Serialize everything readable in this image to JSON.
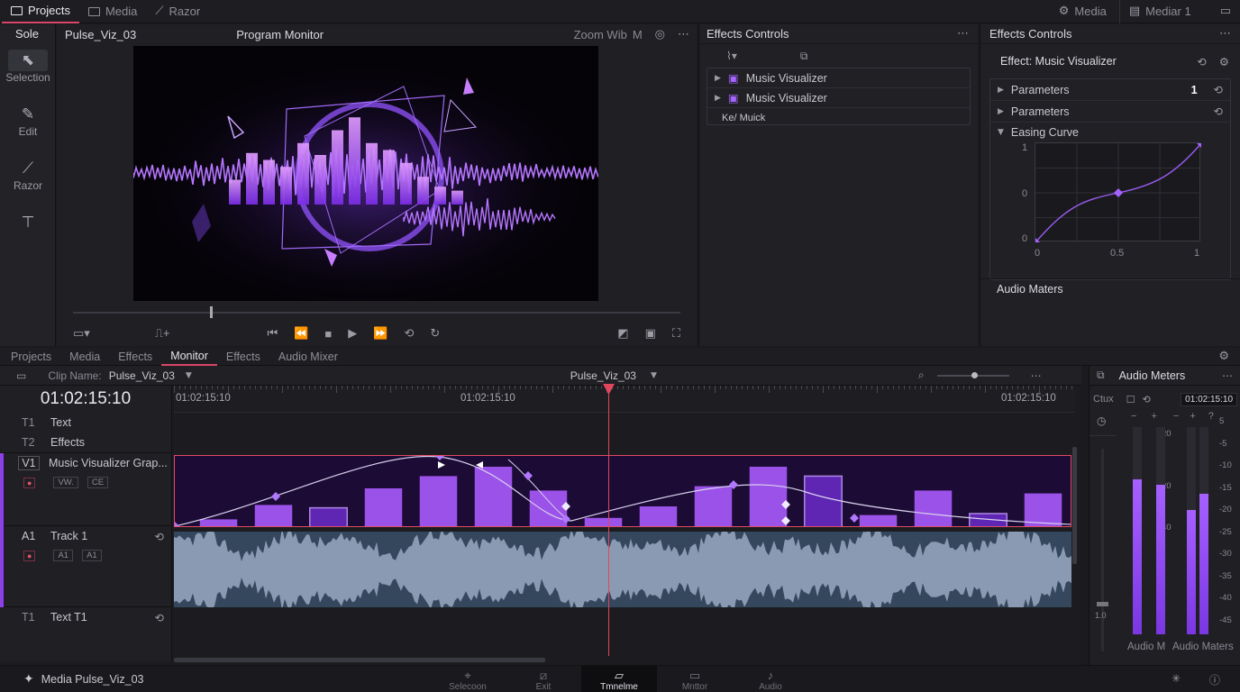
{
  "topbar": {
    "left_tabs": [
      {
        "label": "Projects",
        "icon": "folder-icon"
      },
      {
        "label": "Media",
        "icon": "folder-icon"
      },
      {
        "label": "Razor",
        "icon": "razor-icon"
      }
    ],
    "right_tabs": [
      {
        "label": "Media",
        "icon": "gear-icon"
      },
      {
        "label": "Mediar 1",
        "icon": "media-icon"
      }
    ]
  },
  "tools": {
    "header": "Sole",
    "items": [
      {
        "label": "Selection",
        "icon": "cursor-icon"
      },
      {
        "label": "Edit",
        "icon": "pen-icon"
      },
      {
        "label": "Razor",
        "icon": "razor-icon"
      },
      {
        "label": "",
        "icon": "text-tool-icon"
      }
    ]
  },
  "monitor": {
    "clip_name": "Pulse_Viz_03",
    "title": "Program Monitor",
    "zoom_label": "Zoom Wib",
    "zoom_value": "M"
  },
  "effects_mid": {
    "title": "Effects Controls",
    "items": [
      "Music Visualizer",
      "Music Visualizer"
    ],
    "footer": "Ke/ Muick"
  },
  "effects_right": {
    "title": "Effects Controls",
    "effect_label": "Effect: Music Visualizer",
    "rows": [
      {
        "label": "Parameters",
        "value": "1"
      },
      {
        "label": "Parameters",
        "value": ""
      }
    ],
    "curve_label": "Easing Curve",
    "graph": {
      "y_ticks": [
        "1",
        "0",
        "0"
      ],
      "x_ticks": [
        "0",
        "0.5",
        "1"
      ],
      "points": [
        [
          0,
          0
        ],
        [
          0.5,
          0.5
        ],
        [
          1,
          1
        ]
      ]
    },
    "audio_meters_label": "Audio Maters"
  },
  "lower_tabs": [
    "Projects",
    "Media",
    "Effects",
    "Monitor",
    "Effects",
    "Audio Mixer"
  ],
  "lower_tabs_active": 3,
  "timeline": {
    "clip_name_label": "Clip Name:",
    "clip_name": "Pulse_Viz_03",
    "sequence": "Pulse_Viz_03",
    "timecode": "01:02:15:10",
    "ruler": [
      "01:02:15:10",
      "01:02:15:10",
      "01:02:15:10"
    ],
    "tracks": [
      {
        "id": "T1",
        "name": "Text"
      },
      {
        "id": "T2",
        "name": "Effects"
      },
      {
        "id": "V1",
        "name": "Music Visualizer Grap..."
      },
      {
        "id": "A1",
        "name": "Track 1"
      },
      {
        "id": "T1",
        "name": "Text T1"
      }
    ],
    "v1_badges": [
      "VW.",
      "CE"
    ],
    "a1_badges": [
      "A1",
      "A1"
    ],
    "bars": [
      0.12,
      0.32,
      0.28,
      0.55,
      0.72,
      0.85,
      0.52,
      0.14,
      0.3,
      0.58,
      0.85,
      0.72,
      0.18,
      0.52,
      0.2,
      0.48
    ]
  },
  "meters_panel": {
    "title": "Audio Meters",
    "label_left": "Ctux",
    "timecode": "01:02:15:10",
    "scale_left": [
      "20",
      "20",
      "40"
    ],
    "scale_right": [
      "5",
      "-5",
      "-10",
      "-15",
      "-20",
      "-25",
      "-30",
      "-35",
      "-40",
      "-45"
    ],
    "fader_value": "1.0",
    "levels": [
      0.75,
      0.72,
      0.6,
      0.68
    ],
    "footer_left": "Audio M",
    "footer_right": "Audio Maters"
  },
  "status": {
    "label": "Media Pulse_Viz_03",
    "tabs": [
      "Selecoon",
      "Exit",
      "Tmnelme",
      "Mnttor",
      "Audio"
    ],
    "active": 2
  }
}
